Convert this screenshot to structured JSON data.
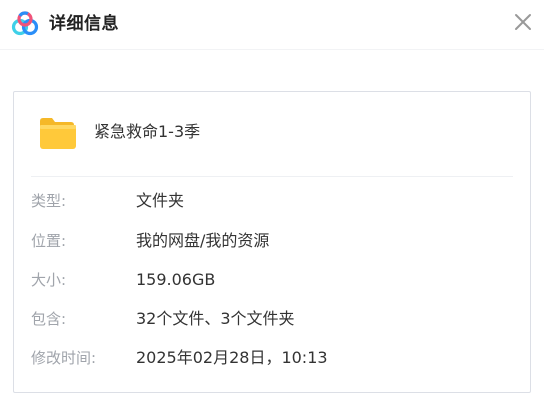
{
  "header": {
    "title": "详细信息",
    "logo_icon": "baidu-netdisk-logo-icon",
    "close_icon": "close-icon"
  },
  "item": {
    "icon": "folder-icon",
    "name": "紧急救命1-3季"
  },
  "details": [
    {
      "label": "类型:",
      "value": "文件夹"
    },
    {
      "label": "位置:",
      "value": "我的网盘/我的资源"
    },
    {
      "label": "大小:",
      "value": "159.06GB"
    },
    {
      "label": "包含:",
      "value": "32个文件、3个文件夹"
    },
    {
      "label": "修改时间:",
      "value": "2025年02月28日，10:13"
    }
  ],
  "colors": {
    "label": "#a0a4ab",
    "value": "#333333",
    "folder": "#ffc93a",
    "logo_blue": "#2a8ef8",
    "logo_cyan": "#3fd0e8",
    "logo_pink": "#f0537a"
  }
}
